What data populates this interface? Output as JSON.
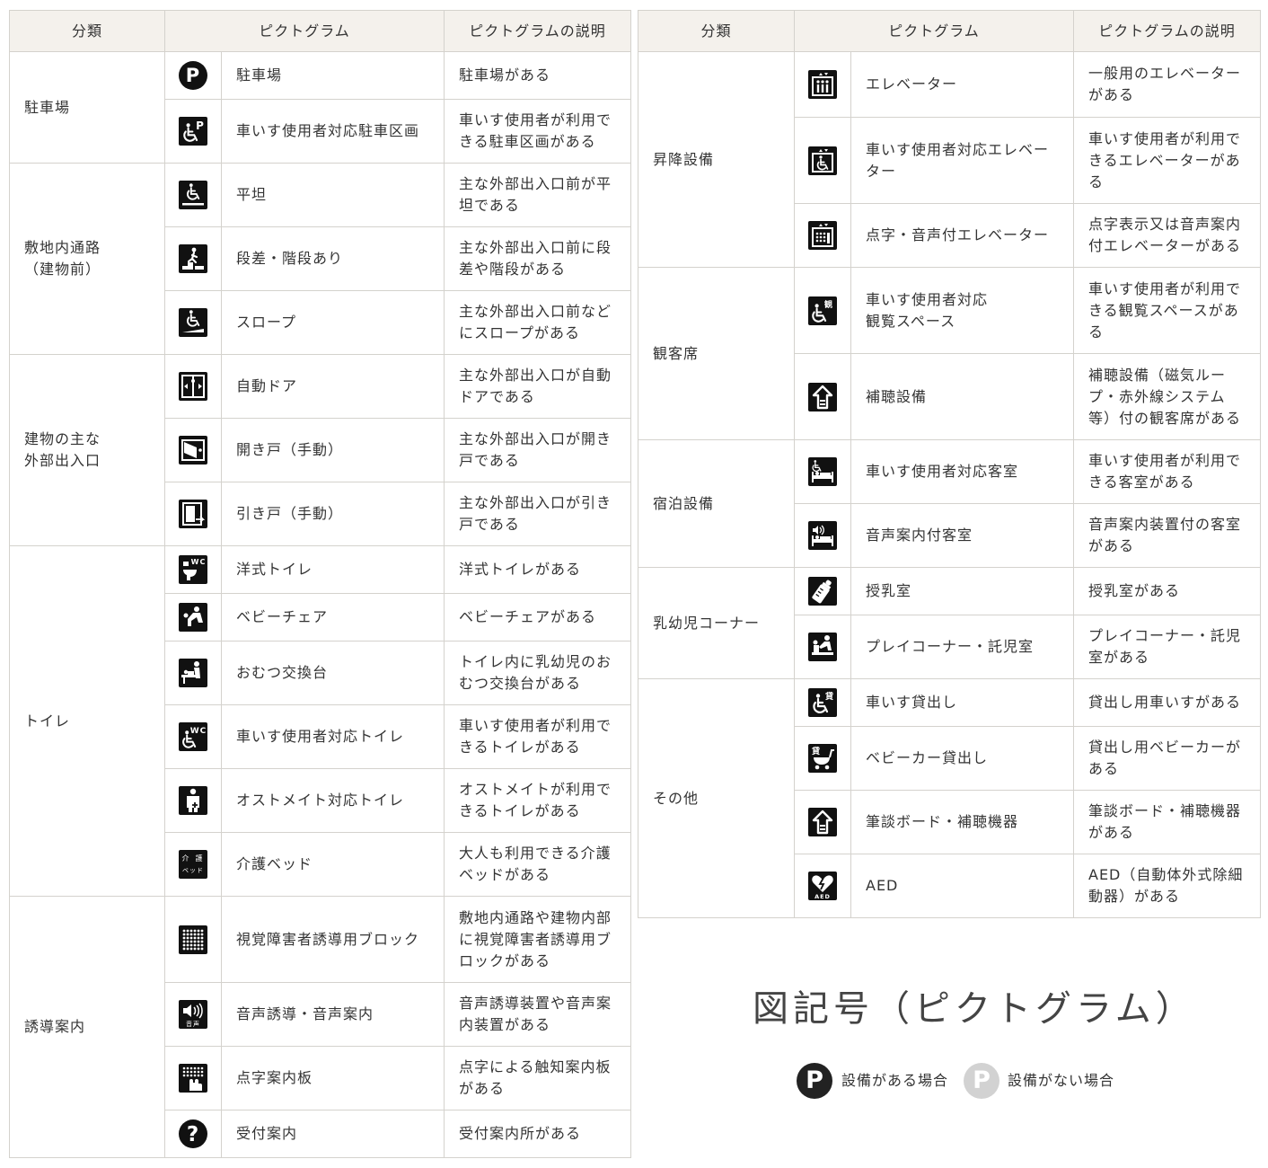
{
  "headers": [
    "分類",
    "ピクトグラム",
    "ピクトグラムの説明"
  ],
  "icon_color": "#111111",
  "left_groups": [
    {
      "category": "駐車場",
      "rows": [
        {
          "icon": "parking-icon",
          "name": "駐車場",
          "desc": "駐車場がある",
          "h": 53
        },
        {
          "icon": "accessible-parking-icon",
          "name": "車いす使用者対応駐車区画",
          "desc": "車いす使用者が利用できる駐車区画がある",
          "h": 71
        }
      ]
    },
    {
      "category": "敷地内通路\n（建物前）",
      "rows": [
        {
          "icon": "flat-entrance-icon",
          "name": "平坦",
          "desc": "主な外部出入口前が平坦である",
          "h": 71
        },
        {
          "icon": "steps-icon",
          "name": "段差・階段あり",
          "desc": "主な外部出入口前に段差や階段がある",
          "h": 71
        },
        {
          "icon": "slope-icon",
          "name": "スロープ",
          "desc": "主な外部出入口前などにスロープがある",
          "h": 71
        }
      ]
    },
    {
      "category": "建物の主な\n外部出入口",
      "rows": [
        {
          "icon": "automatic-door-icon",
          "name": "自動ドア",
          "desc": "主な外部出入口が自動ドアである",
          "h": 71
        },
        {
          "icon": "hinged-door-icon",
          "name": "開き戸（手動）",
          "desc": "主な外部出入口が開き戸である",
          "h": 71
        },
        {
          "icon": "sliding-door-icon",
          "name": "引き戸（手動）",
          "desc": "主な外部出入口が引き戸である",
          "h": 71
        }
      ]
    },
    {
      "category": "トイレ",
      "rows": [
        {
          "icon": "western-toilet-icon",
          "name": "洋式トイレ",
          "desc": "洋式トイレがある",
          "h": 53
        },
        {
          "icon": "baby-chair-icon",
          "name": "ベビーチェア",
          "desc": "ベビーチェアがある",
          "h": 53
        },
        {
          "icon": "diaper-changing-icon",
          "name": "おむつ交換台",
          "desc": "トイレ内に乳幼児のおむつ交換台がある",
          "h": 71
        },
        {
          "icon": "accessible-toilet-icon",
          "name": "車いす使用者対応トイレ",
          "desc": "車いす使用者が利用できるトイレがある",
          "h": 71
        },
        {
          "icon": "ostomate-icon",
          "name": "オストメイト対応トイレ",
          "desc": "オストメイトが利用できるトイレがある",
          "h": 71
        },
        {
          "icon": "care-bed-icon",
          "name": "介護ベッド",
          "desc": "大人も利用できる介護ベッドがある",
          "h": 71
        }
      ]
    },
    {
      "category": "誘導案内",
      "rows": [
        {
          "icon": "tactile-block-icon",
          "name": "視覚障害者誘導用ブロック",
          "desc": "敷地内通路や建物内部に視覚障害者誘導用ブロックがある",
          "h": 96
        },
        {
          "icon": "audio-guide-icon",
          "name": "音声誘導・音声案内",
          "desc": "音声誘導装置や音声案内装置がある",
          "h": 71
        },
        {
          "icon": "braille-board-icon",
          "name": "点字案内板",
          "desc": "点字による触知案内板がある",
          "h": 71
        },
        {
          "icon": "information-icon",
          "name": "受付案内",
          "desc": "受付案内所がある",
          "h": 53
        }
      ]
    }
  ],
  "right_groups": [
    {
      "category": "昇降設備",
      "rows": [
        {
          "icon": "elevator-icon",
          "name": "エレベーター",
          "desc": "一般用のエレベーターがある",
          "h": 73
        },
        {
          "icon": "accessible-elevator-icon",
          "name": "車いす使用者対応エレベーター",
          "desc": "車いす使用者が利用できるエレベーターがある",
          "h": 96
        },
        {
          "icon": "braille-elevator-icon",
          "name": "点字・音声付エレベーター",
          "desc": "点字表示又は音声案内付エレベーターがある",
          "h": 71
        }
      ]
    },
    {
      "category": "観客席",
      "rows": [
        {
          "icon": "accessible-seating-icon",
          "name": "車いす使用者対応\n観覧スペース",
          "desc": "車いす使用者が利用できる観覧スペースがある",
          "h": 96
        },
        {
          "icon": "hearing-assistance-icon",
          "name": "補聴設備",
          "desc": "補聴設備（磁気ループ・赤外線システム等）付の観客席がある",
          "h": 96
        }
      ]
    },
    {
      "category": "宿泊設備",
      "rows": [
        {
          "icon": "accessible-room-icon",
          "name": "車いす使用者対応客室",
          "desc": "車いす使用者が利用できる客室がある",
          "h": 71
        },
        {
          "icon": "audio-room-icon",
          "name": "音声案内付客室",
          "desc": "音声案内装置付の客室がある",
          "h": 71
        }
      ]
    },
    {
      "category": "乳幼児コーナー",
      "rows": [
        {
          "icon": "nursing-room-icon",
          "name": "授乳室",
          "desc": "授乳室がある",
          "h": 53
        },
        {
          "icon": "play-corner-icon",
          "name": "プレイコーナー・託児室",
          "desc": "プレイコーナー・託児室がある",
          "h": 71
        }
      ]
    },
    {
      "category": "その他",
      "rows": [
        {
          "icon": "wheelchair-rental-icon",
          "name": "車いす貸出し",
          "desc": "貸出し用車いすがある",
          "h": 53
        },
        {
          "icon": "stroller-rental-icon",
          "name": "ベビーカー貸出し",
          "desc": "貸出し用ベビーカーがある",
          "h": 71
        },
        {
          "icon": "writing-board-icon",
          "name": "筆談ボード・補聴機器",
          "desc": "筆談ボード・補聴機器がある",
          "h": 71
        },
        {
          "icon": "aed-icon",
          "name": "AED",
          "desc": "AED（自動体外式除細動器）がある",
          "h": 71
        }
      ]
    }
  ],
  "caption": "図記号（ピクトグラム）",
  "legend": {
    "badge_letter": "P",
    "present_label": "設備がある場合",
    "present_color": "#222222",
    "absent_label": "設備がない場合",
    "absent_color": "#d2d2d2"
  }
}
